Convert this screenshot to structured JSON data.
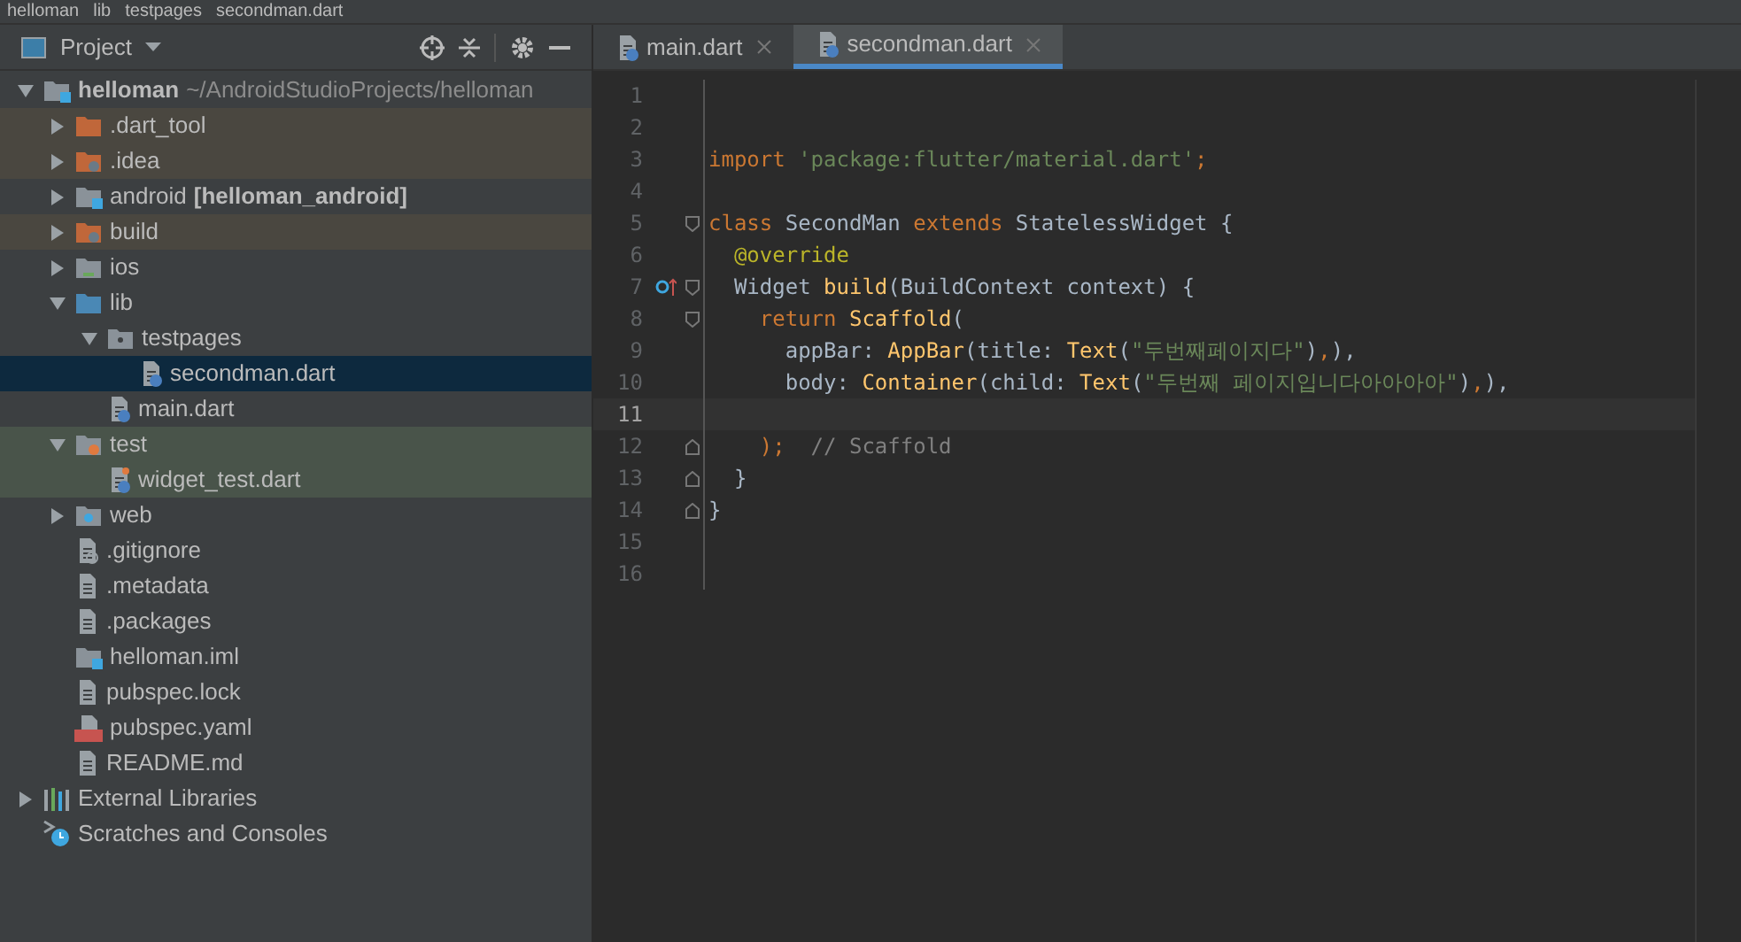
{
  "breadcrumb": [
    "helloman",
    "lib",
    "testpages",
    "secondman.dart"
  ],
  "project_panel": {
    "title": "Project",
    "tree": [
      {
        "label": "helloman",
        "path": "~/AndroidStudioProjects/helloman",
        "kind": "module",
        "bold": true,
        "expanded": true,
        "excluded": false,
        "in_test": false,
        "selected": false,
        "children": [
          {
            "label": ".dart_tool",
            "kind": "folder",
            "expanded": false,
            "excluded": true,
            "in_test": false,
            "selected": false
          },
          {
            "label": ".idea",
            "kind": "config",
            "expanded": false,
            "excluded": true,
            "in_test": false,
            "selected": false
          },
          {
            "label": "android",
            "module": "[helloman_android]",
            "kind": "module",
            "expanded": false,
            "excluded": false,
            "in_test": false,
            "selected": false
          },
          {
            "label": "build",
            "kind": "config",
            "expanded": false,
            "excluded": true,
            "in_test": false,
            "selected": false
          },
          {
            "label": "ios",
            "kind": "ios",
            "expanded": false,
            "excluded": false,
            "in_test": false,
            "selected": false
          },
          {
            "label": "lib",
            "kind": "source",
            "expanded": true,
            "excluded": false,
            "in_test": false,
            "selected": false,
            "children": [
              {
                "label": "testpages",
                "kind": "package",
                "expanded": true,
                "excluded": false,
                "in_test": false,
                "selected": false,
                "children": [
                  {
                    "label": "secondman.dart",
                    "kind": "dart",
                    "excluded": false,
                    "in_test": false,
                    "selected": true
                  }
                ]
              },
              {
                "label": "main.dart",
                "kind": "dart",
                "excluded": false,
                "in_test": false,
                "selected": false
              }
            ]
          },
          {
            "label": "test",
            "kind": "testroot",
            "expanded": true,
            "excluded": false,
            "in_test": true,
            "selected": false,
            "children": [
              {
                "label": "widget_test.dart",
                "kind": "darttest",
                "excluded": false,
                "in_test": true,
                "selected": false
              }
            ]
          },
          {
            "label": "web",
            "kind": "web",
            "expanded": false,
            "excluded": false,
            "in_test": false,
            "selected": false
          },
          {
            "label": ".gitignore",
            "kind": "ignore",
            "excluded": false,
            "in_test": false,
            "selected": false
          },
          {
            "label": ".metadata",
            "kind": "text",
            "excluded": false,
            "in_test": false,
            "selected": false
          },
          {
            "label": ".packages",
            "kind": "text",
            "excluded": false,
            "in_test": false,
            "selected": false
          },
          {
            "label": "helloman.iml",
            "kind": "module",
            "excluded": false,
            "in_test": false,
            "selected": false
          },
          {
            "label": "pubspec.lock",
            "kind": "text",
            "excluded": false,
            "in_test": false,
            "selected": false
          },
          {
            "label": "pubspec.yaml",
            "kind": "yaml",
            "excluded": false,
            "in_test": false,
            "selected": false
          },
          {
            "label": "README.md",
            "kind": "text",
            "excluded": false,
            "in_test": false,
            "selected": false
          }
        ]
      },
      {
        "label": "External Libraries",
        "kind": "libraries",
        "expanded": false,
        "excluded": false,
        "in_test": false,
        "selected": false
      },
      {
        "label": "Scratches and Consoles",
        "kind": "scratches",
        "excluded": false,
        "in_test": false,
        "selected": false
      }
    ]
  },
  "editor_tabs": [
    {
      "label": "main.dart",
      "selected": false
    },
    {
      "label": "secondman.dart",
      "selected": true
    }
  ],
  "code_lines": [
    {
      "number": "1",
      "current": false
    },
    {
      "number": "2",
      "current": false
    },
    {
      "number": "3",
      "current": false,
      "tokens": [
        {
          "kind": "keyword",
          "text": "import "
        },
        {
          "kind": "string",
          "text": "'package:flutter/material.dart'"
        },
        {
          "kind": "keyword",
          "text": ";"
        }
      ]
    },
    {
      "number": "4",
      "current": false
    },
    {
      "number": "5",
      "current": false,
      "fold_start": true,
      "tokens": [
        {
          "kind": "keyword",
          "text": "class "
        },
        {
          "kind": "plain",
          "text": "SecondMan "
        },
        {
          "kind": "keyword",
          "text": "extends "
        },
        {
          "kind": "plain",
          "text": "StatelessWidget {"
        }
      ]
    },
    {
      "number": "6",
      "current": false,
      "tokens": [
        {
          "kind": "annotation",
          "text": "  @override"
        }
      ]
    },
    {
      "number": "7",
      "current": false,
      "fold_start": true,
      "override_marker": true,
      "tokens": [
        {
          "kind": "plain",
          "text": "  Widget "
        },
        {
          "kind": "function",
          "text": "build"
        },
        {
          "kind": "plain",
          "text": "(BuildContext context) {"
        }
      ]
    },
    {
      "number": "8",
      "current": false,
      "fold_start": true,
      "tokens": [
        {
          "kind": "keyword",
          "text": "    return "
        },
        {
          "kind": "function",
          "text": "Scaffold"
        },
        {
          "kind": "plain",
          "text": "("
        }
      ]
    },
    {
      "number": "9",
      "current": false,
      "tokens": [
        {
          "kind": "plain",
          "text": "      appBar: "
        },
        {
          "kind": "function",
          "text": "AppBar"
        },
        {
          "kind": "plain",
          "text": "(title: "
        },
        {
          "kind": "function",
          "text": "Text"
        },
        {
          "kind": "plain",
          "text": "("
        },
        {
          "kind": "string",
          "text": "\"두번째페이지다\""
        },
        {
          "kind": "plain",
          "text": ")"
        },
        {
          "kind": "keyword",
          "text": ","
        },
        {
          "kind": "plain",
          "text": "),"
        }
      ]
    },
    {
      "number": "10",
      "current": false,
      "tokens": [
        {
          "kind": "plain",
          "text": "      body: "
        },
        {
          "kind": "function",
          "text": "Container"
        },
        {
          "kind": "plain",
          "text": "(child: "
        },
        {
          "kind": "function",
          "text": "Text"
        },
        {
          "kind": "plain",
          "text": "("
        },
        {
          "kind": "string",
          "text": "\"두번째 페이지입니다아아아아\""
        },
        {
          "kind": "plain",
          "text": ")"
        },
        {
          "kind": "keyword",
          "text": ","
        },
        {
          "kind": "plain",
          "text": "),"
        }
      ]
    },
    {
      "number": "11",
      "current": true
    },
    {
      "number": "12",
      "current": false,
      "fold_end": true,
      "tokens": [
        {
          "kind": "keyword",
          "text": "    );"
        },
        {
          "kind": "comment",
          "text": "  // Scaffold"
        }
      ]
    },
    {
      "number": "13",
      "current": false,
      "fold_end": true,
      "tokens": [
        {
          "kind": "plain",
          "text": "  }"
        }
      ]
    },
    {
      "number": "14",
      "current": false,
      "fold_end": true,
      "tokens": [
        {
          "kind": "plain",
          "text": "}"
        }
      ]
    },
    {
      "number": "15",
      "current": false
    },
    {
      "number": "16",
      "current": false
    }
  ]
}
